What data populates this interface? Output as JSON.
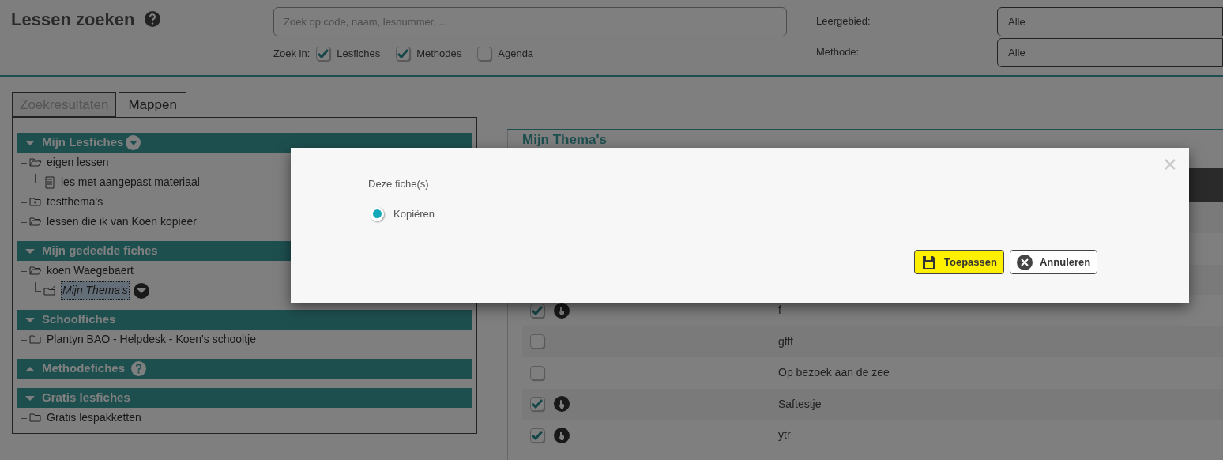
{
  "header": {
    "title": "Lessen zoeken",
    "search": {
      "placeholder": "Zoek op code, naam, lesnummer, ..."
    },
    "search_in_label": "Zoek in:",
    "search_in": [
      {
        "label": "Lesfiches",
        "checked": true
      },
      {
        "label": "Methodes",
        "checked": true
      },
      {
        "label": "Agenda",
        "checked": false
      }
    ],
    "filters": [
      {
        "label": "Leergebied:",
        "value": "Alle"
      },
      {
        "label": "Methode:",
        "value": "Alle"
      }
    ]
  },
  "tabs": [
    {
      "label": "Zoekresultaten",
      "selected": false
    },
    {
      "label": "Mappen",
      "selected": true
    }
  ],
  "sections": [
    {
      "title": "Mijn Lesfiches",
      "expanded": true,
      "menu": true,
      "children": [
        {
          "label": "eigen lessen",
          "kind": "folder-open",
          "children": [
            {
              "label": "les met aangepast materiaal",
              "kind": "document"
            }
          ]
        },
        {
          "label": "testthema's",
          "kind": "shared-folder"
        },
        {
          "label": "lessen die ik van Koen kopieer",
          "kind": "folder-open"
        }
      ]
    },
    {
      "title": "Mijn gedeelde fiches",
      "expanded": true,
      "children": [
        {
          "label": "koen Waegebaert",
          "kind": "folder-open",
          "children": [
            {
              "label": "Mijn Thema's",
              "kind": "edit-folder",
              "selected": true
            }
          ]
        }
      ]
    },
    {
      "title": "Schoolfiches",
      "expanded": true,
      "children": [
        {
          "label": "Plantyn BAO - Helpdesk - Koen's schooltje",
          "kind": "folder"
        }
      ]
    },
    {
      "title": "Methodefiches",
      "expanded": false,
      "help": true
    },
    {
      "title": "Gratis lesfiches",
      "expanded": true,
      "children": [
        {
          "label": "Gratis lespakketten",
          "kind": "folder"
        }
      ]
    }
  ],
  "panel": {
    "title": "Mijn Thema's",
    "rows": [
      {
        "title": "f",
        "checked": true
      },
      {
        "title": "gfff",
        "checked": false
      },
      {
        "title": "Op bezoek aan de zee",
        "checked": false
      },
      {
        "title": "Saftestje",
        "checked": true
      },
      {
        "title": "ytr",
        "checked": true
      }
    ]
  },
  "dialog": {
    "heading": "Deze fiche(s)",
    "options": [
      {
        "label": "Kopiëren",
        "selected": true
      }
    ],
    "buttons": [
      {
        "label": "Toepassen",
        "kind": "apply",
        "highlighted": true
      },
      {
        "label": "Annuleren",
        "kind": "cancel",
        "highlighted": false
      }
    ]
  }
}
